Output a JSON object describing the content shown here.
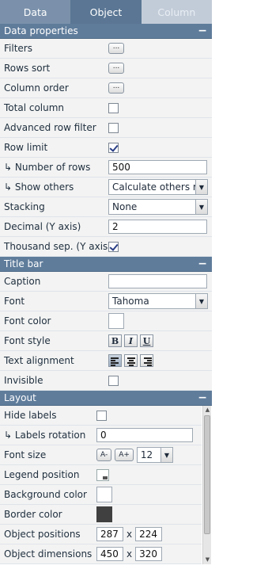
{
  "tabs": [
    {
      "label": "Data",
      "state": "normal"
    },
    {
      "label": "Object",
      "state": "active"
    },
    {
      "label": "Column",
      "state": "disabled"
    }
  ],
  "sections": {
    "data_properties": {
      "title": "Data properties",
      "collapse_symbol": "−",
      "rows": {
        "filters": "Filters",
        "rows_sort": "Rows sort",
        "column_order": "Column order",
        "total_column": "Total column",
        "advanced_row_filter": "Advanced row filter",
        "row_limit": "Row limit",
        "number_of_rows": "↳ Number of rows",
        "show_others": "↳ Show others",
        "stacking": "Stacking",
        "decimal_y": "Decimal (Y axis)",
        "thousand_sep": "Thousand sep. (Y axis)"
      },
      "values": {
        "dots": "...",
        "number_of_rows": "500",
        "show_others": "Calculate others row",
        "stacking": "None",
        "decimal_y": "2"
      }
    },
    "title_bar": {
      "title": "Title bar",
      "collapse_symbol": "−",
      "rows": {
        "caption": "Caption",
        "font": "Font",
        "font_color": "Font color",
        "font_style": "Font style",
        "text_alignment": "Text alignment",
        "invisible": "Invisible"
      },
      "values": {
        "caption": "",
        "font": "Tahoma",
        "bold": "B",
        "italic": "I",
        "underline": "U"
      }
    },
    "layout": {
      "title": "Layout",
      "collapse_symbol": "−",
      "rows": {
        "hide_labels": "Hide labels",
        "labels_rotation": "↳ Labels rotation",
        "font_size": "Font size",
        "legend_position": "Legend position",
        "background_color": "Background color",
        "border_color": "Border color",
        "object_positions": "Object positions",
        "object_dimensions": "Object dimensions"
      },
      "values": {
        "labels_rotation": "0",
        "font_decrease": "A-",
        "font_increase": "A+",
        "font_size": "12",
        "pos_x": "287",
        "pos_y": "224",
        "dim_w": "450",
        "dim_h": "320",
        "times": "x"
      }
    }
  },
  "colors": {
    "header_bg": "#5f7c9b",
    "row_bg": "#f3f3f3",
    "border_color_swatch": "#404040",
    "font_color_swatch": "#ffffff"
  }
}
